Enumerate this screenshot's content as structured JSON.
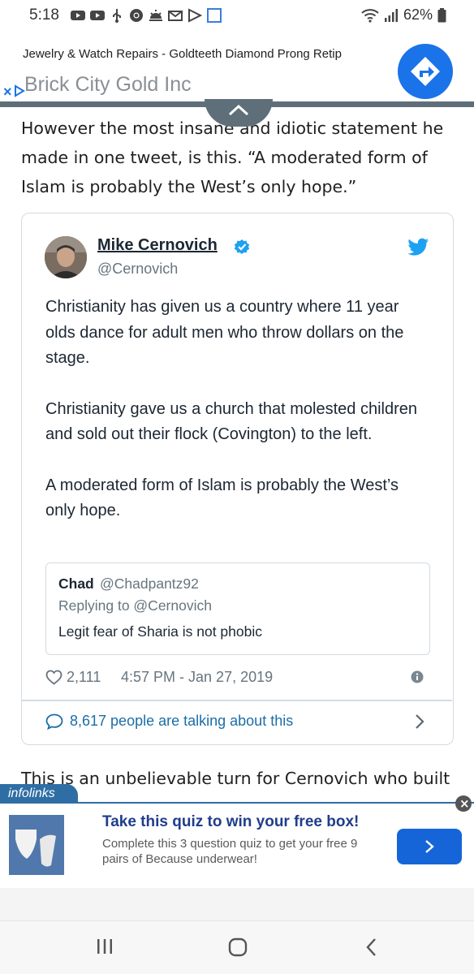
{
  "status_bar": {
    "time": "5:18",
    "battery": "62%",
    "icons": [
      "youtube-icon",
      "youtube-icon",
      "usb-icon",
      "chrome-icon",
      "weather-icon",
      "mail-icon",
      "play-icon",
      "square-icon",
      "wifi-icon",
      "signal-icon",
      "battery-icon"
    ]
  },
  "top_ad": {
    "headline": "Jewelry & Watch Repairs - Goldteeth Diamond Prong Retip",
    "advertiser": "Brick City Gold Inc"
  },
  "article": {
    "paragraph_1": "However the most insane and idiotic statement he made in one tweet, is this. “A moderated form of Islam is probably the West’s only hope.”",
    "paragraph_2": "This is an unbelievable turn for Cernovich who built"
  },
  "tweet": {
    "author_name": "Mike Cernovich",
    "author_handle": "@Cernovich",
    "paragraphs": [
      "Christianity has given us a country where 11 year olds dance for adult men who throw dollars on the stage.",
      "Christianity gave us a church that molested children and sold out their flock (Covington) to the left.",
      "A moderated form of Islam is probably the West’s only hope."
    ],
    "quoted": {
      "name": "Chad",
      "handle": "@Chadpantz92",
      "replying_to": "Replying to @Cernovich",
      "text": "Legit fear of Sharia is not phobic"
    },
    "like_count": "2,111",
    "timestamp": "4:57 PM - Jan 27, 2019",
    "talking": "8,617 people are talking about this"
  },
  "bottom_ad": {
    "brand_tag": "infolinks",
    "title": "Take this quiz to win your free box!",
    "description": "Complete this 3 question quiz to get your free 9 pairs of Because underwear!",
    "close_label": "×"
  },
  "colors": {
    "twitter_blue": "#1da1f2",
    "link_blue": "#1b6ea6",
    "ad_blue": "#1a73e8",
    "infolinks_blue": "#2f6ea5"
  }
}
